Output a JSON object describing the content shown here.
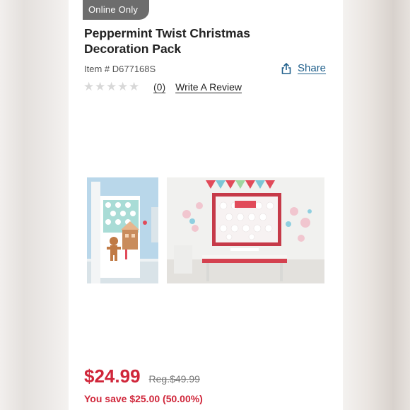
{
  "badge": "Online Only",
  "product": {
    "title": "Peppermint Twist Christmas Decoration Pack",
    "item_number": "Item # D677168S"
  },
  "share": {
    "label": "Share",
    "icon": "share-icon"
  },
  "rating": {
    "stars": 0,
    "max_stars": 5,
    "count": "(0)",
    "write_review": "Write A Review"
  },
  "images": [
    {
      "icon": "door-decoration-photo"
    },
    {
      "icon": "bulletin-board-photo"
    }
  ],
  "pricing": {
    "price": "$24.99",
    "regular": "Reg.$49.99",
    "savings": "You save $25.00 (50.00%)"
  },
  "colors": {
    "badge_bg": "#6d6d6d",
    "link": "#1f5f8b",
    "price": "#d0263a"
  }
}
